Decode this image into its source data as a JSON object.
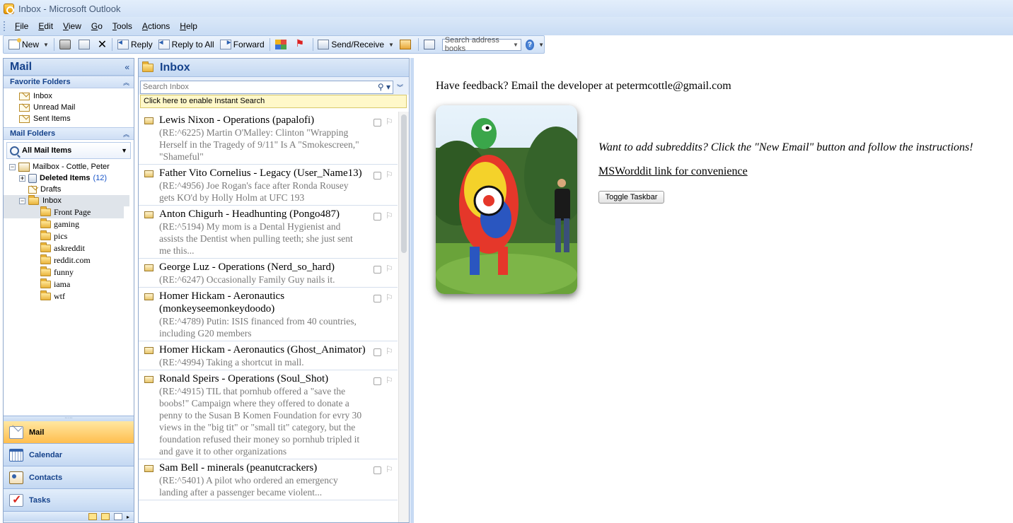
{
  "window": {
    "title": "Inbox - Microsoft Outlook"
  },
  "menu": [
    "File",
    "Edit",
    "View",
    "Go",
    "Tools",
    "Actions",
    "Help"
  ],
  "toolbar": {
    "new_label": "New",
    "reply_label": "Reply",
    "reply_all_label": "Reply to All",
    "forward_label": "Forward",
    "send_receive_label": "Send/Receive",
    "search_address_placeholder": "Search address books"
  },
  "nav": {
    "title": "Mail",
    "favorites_title": "Favorite Folders",
    "favorites": [
      "Inbox",
      "Unread Mail",
      "Sent Items"
    ],
    "mail_folders_title": "Mail Folders",
    "all_mail_label": "All Mail Items",
    "mailbox_label": "Mailbox - Cottle, Peter",
    "deleted_label": "Deleted Items",
    "deleted_count": "(12)",
    "drafts_label": "Drafts",
    "inbox_label": "Inbox",
    "subfolders": [
      "Front Page",
      "gaming",
      "pics",
      "askreddit",
      "reddit.com",
      "funny",
      "iama",
      "wtf"
    ],
    "buttons": [
      "Mail",
      "Calendar",
      "Contacts",
      "Tasks"
    ]
  },
  "list": {
    "title": "Inbox",
    "search_placeholder": "Search Inbox",
    "instant_search": "Click here to enable Instant Search",
    "items": [
      {
        "from": "Lewis Nixon - Operations (papalofi)",
        "subject": "(RE:^6225) Martin O'Malley: Clinton \"Wrapping Herself in the Tragedy of 9/11\" Is A \"Smokescreen,\" \"Shameful\""
      },
      {
        "from": "Father Vito Cornelius - Legacy (User_Name13)",
        "subject": "(RE:^4956) Joe Rogan's face after Ronda Rousey gets KO'd by Holly Holm at UFC 193"
      },
      {
        "from": "Anton Chigurh - Headhunting (Pongo487)",
        "subject": "(RE:^5194) My mom is a Dental Hygienist and assists the Dentist when pulling teeth; she just sent me this..."
      },
      {
        "from": "George Luz - Operations (Nerd_so_hard)",
        "subject": "(RE:^6247) Occasionally Family Guy nails it."
      },
      {
        "from": "Homer Hickam - Aeronautics (monkeyseemonkeydoodo)",
        "subject": "(RE:^4789) Putin: ISIS financed from 40 countries, including G20 members"
      },
      {
        "from": "Homer Hickam - Aeronautics (Ghost_Animator)",
        "subject": "(RE:^4994) Taking a shortcut in mall."
      },
      {
        "from": "Ronald Speirs - Operations (Soul_Shot)",
        "subject": "(RE:^4915) TIL that pornhub offered a \"save the boobs!\" Campaign where they offered to donate a penny to the Susan B Komen Foundation for evry 30 views in the \"big tit\" or \"small tit\" category, but the foundation refused their money so pornhub tripled it and gave it to other organizations"
      },
      {
        "from": "Sam Bell - minerals (peanutcrackers)",
        "subject": "(RE:^5401) A pilot who ordered an emergency landing after a passenger became violent..."
      }
    ]
  },
  "reading": {
    "feedback": "Have feedback? Email the developer at petermcottle@gmail.com",
    "instructions": "Want to add subreddits? Click the \"New Email\" button and follow the instructions!",
    "link_label": "MSWorddit link for convenience",
    "toggle_label": "Toggle Taskbar"
  }
}
